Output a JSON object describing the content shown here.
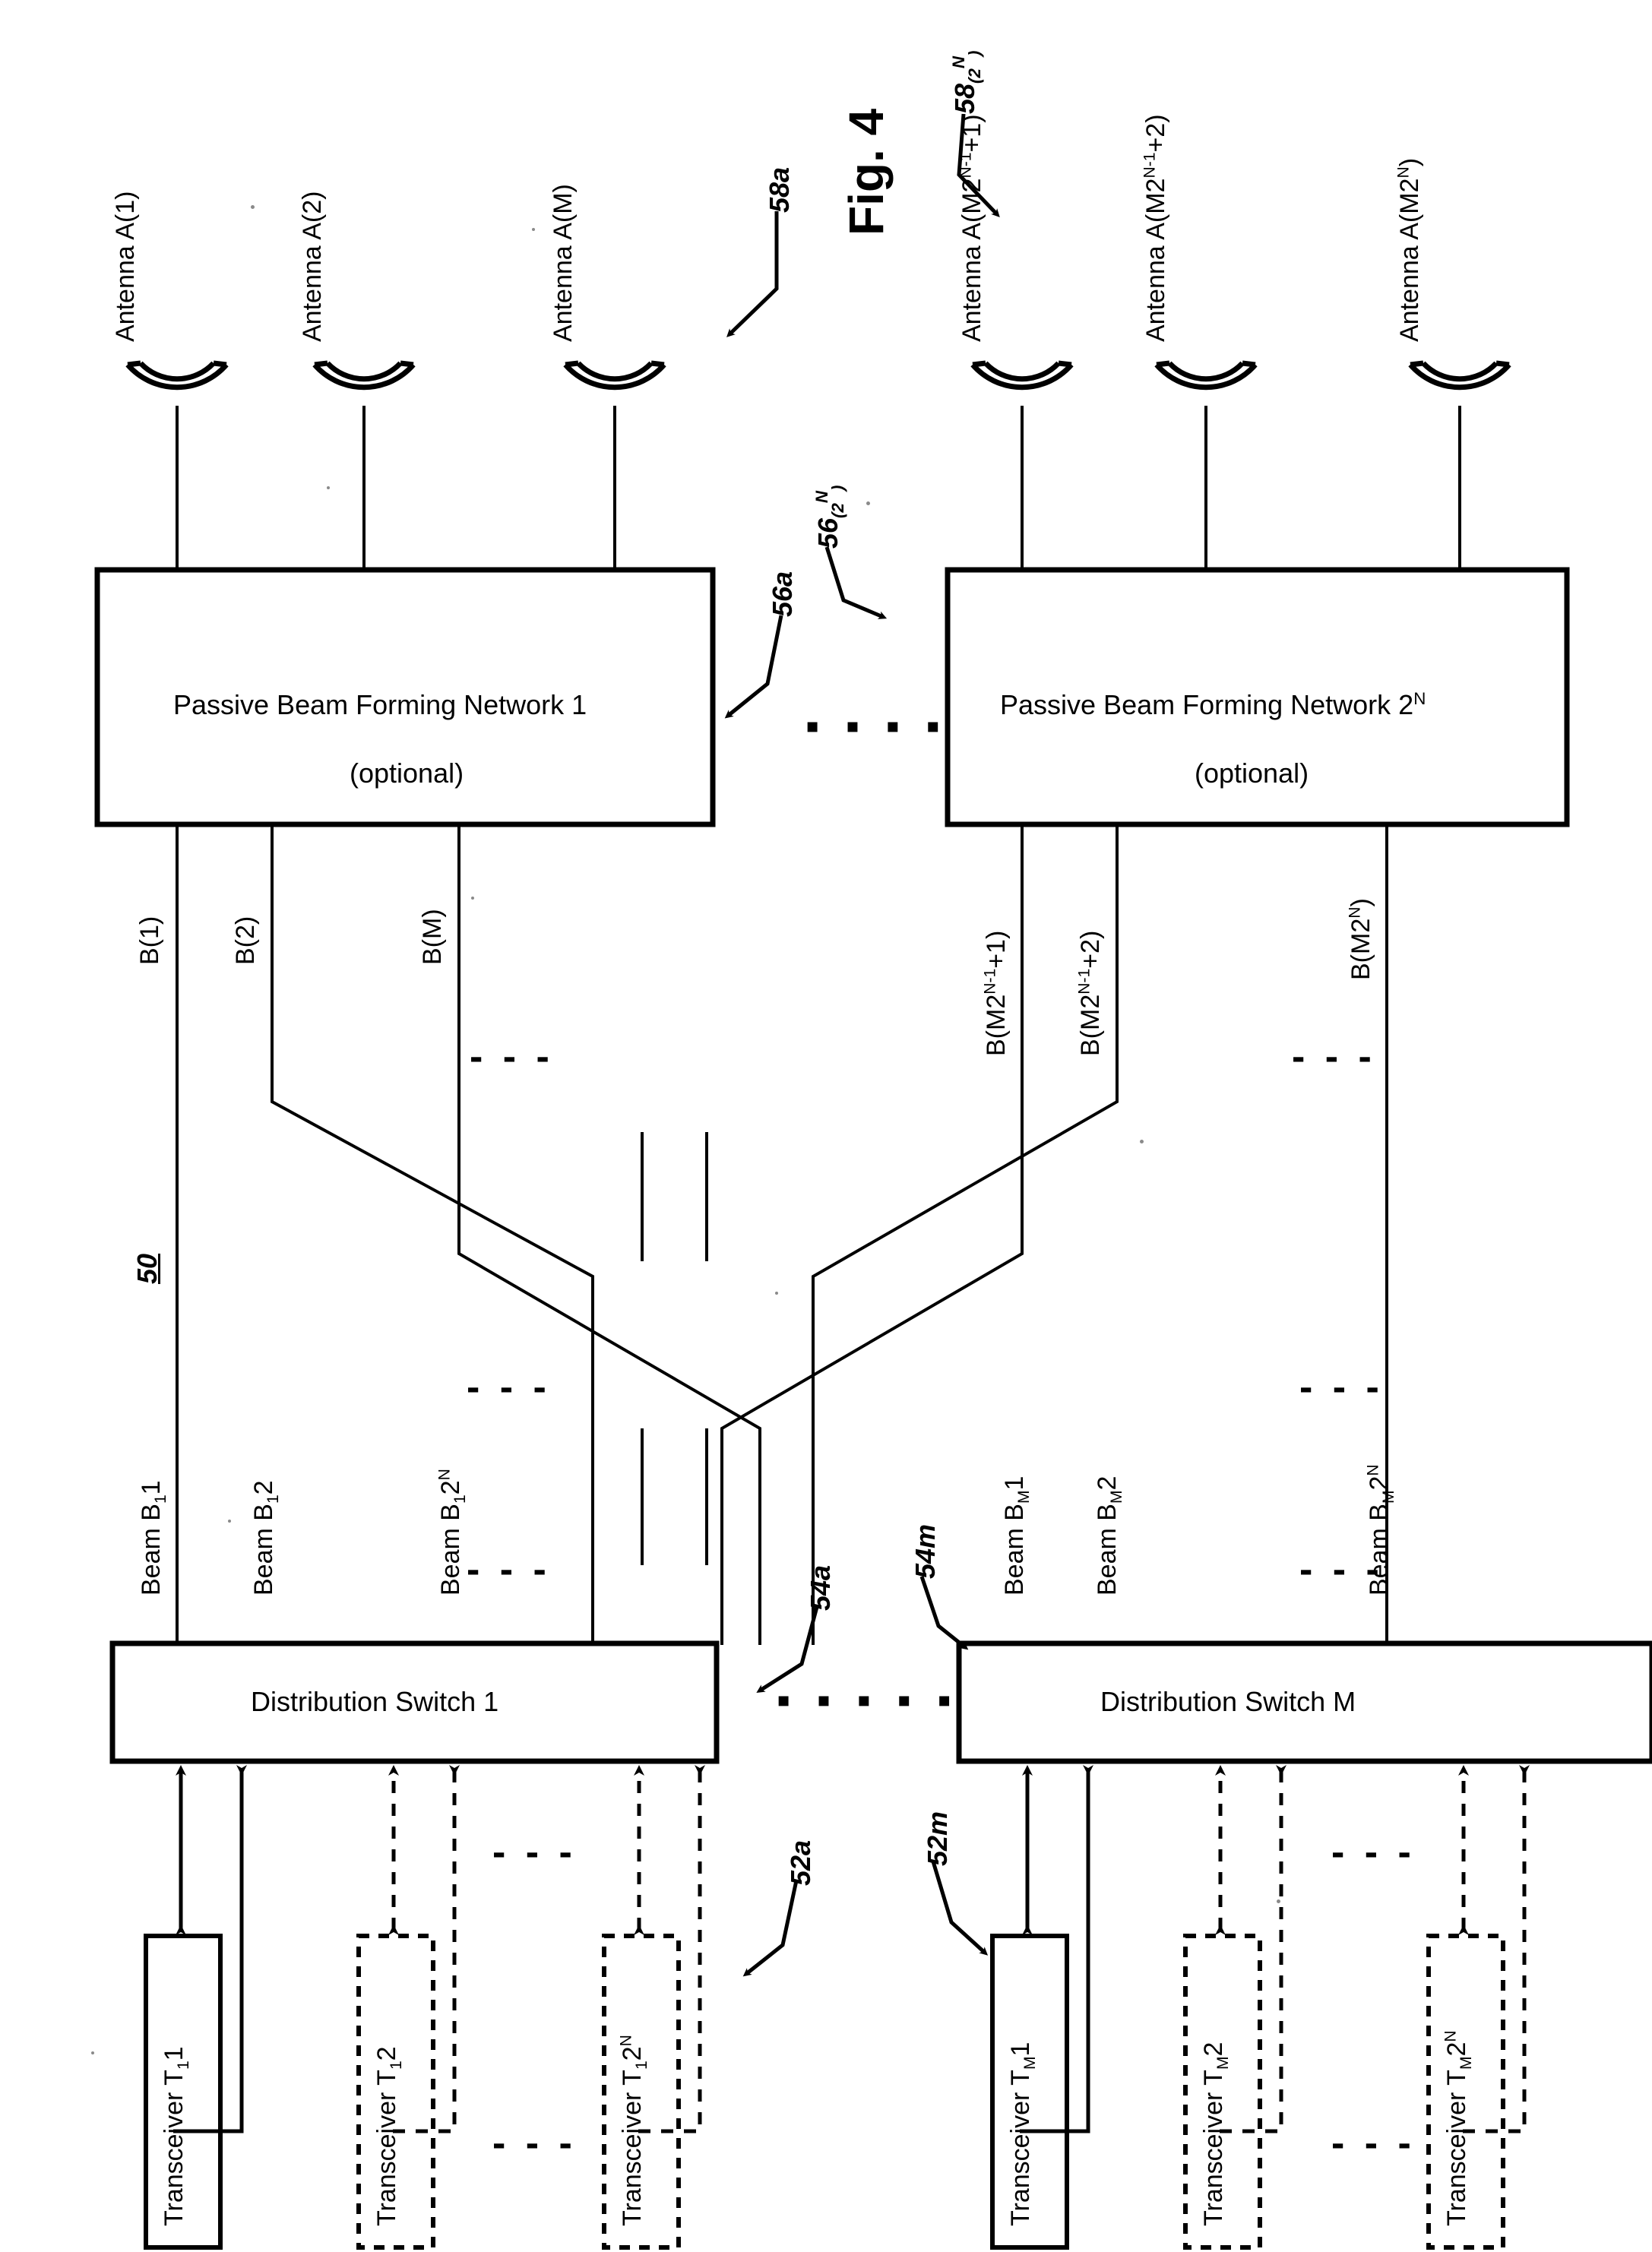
{
  "figure": {
    "caption": "Fig. 4",
    "system_ref": "50"
  },
  "antennas": {
    "left_group_ref": "58a",
    "right_group_ref": "58(2N)",
    "left": [
      {
        "label": "Antenna A(1)"
      },
      {
        "label": "Antenna A(2)"
      },
      {
        "label": "Antenna A(M)"
      }
    ],
    "right": [
      {
        "label": "Antenna A(M2N-1+1)"
      },
      {
        "label": "Antenna A(M2N-1+2)"
      },
      {
        "label": "Antenna A(M2N)"
      }
    ]
  },
  "beam_forming_networks": {
    "left_ref": "56a",
    "right_ref": "56(2N)",
    "left": {
      "title": "Passive Beam Forming Network 1",
      "subtitle": "(optional)"
    },
    "right": {
      "title_prefix": "Passive Beam Forming Network 2",
      "title_sup": "N",
      "subtitle": "(optional)"
    }
  },
  "bfn_ports": {
    "left": [
      {
        "label": "B(1)"
      },
      {
        "label": "B(2)"
      },
      {
        "label": "B(M)"
      }
    ],
    "right": [
      {
        "label": "B(M2N-1+1)"
      },
      {
        "label": "B(M2N-1+2)"
      },
      {
        "label": "B(M2N)"
      }
    ]
  },
  "beams": {
    "left": [
      {
        "label": "Beam B11"
      },
      {
        "label": "Beam B12"
      },
      {
        "label": "Beam B12N"
      }
    ],
    "right": [
      {
        "label": "Beam BM1"
      },
      {
        "label": "Beam BM2"
      },
      {
        "label": "Beam BM2N"
      }
    ]
  },
  "distribution_switches": {
    "left_ref": "54a",
    "right_ref": "54m",
    "left_label": "Distribution Switch 1",
    "right_label": "Distribution Switch M"
  },
  "transceivers": {
    "left_ref": "52a",
    "right_ref": "52m",
    "left": [
      {
        "label": "Transceiver T11",
        "style": "solid"
      },
      {
        "label": "Transceiver T12",
        "style": "dashed"
      },
      {
        "label": "Transceiver T12N",
        "style": "dashed"
      }
    ],
    "right": [
      {
        "label": "Transceiver TM1",
        "style": "solid"
      },
      {
        "label": "Transceiver TM2",
        "style": "dashed"
      },
      {
        "label": "Transceiver TM2N",
        "style": "dashed"
      }
    ]
  },
  "ellipses": {
    "glyph": "- - -",
    "dashed_connector": "▪ ▪ ▪ ▪ ▪"
  },
  "colors": {
    "ink": "#000000",
    "paper": "#ffffff"
  }
}
